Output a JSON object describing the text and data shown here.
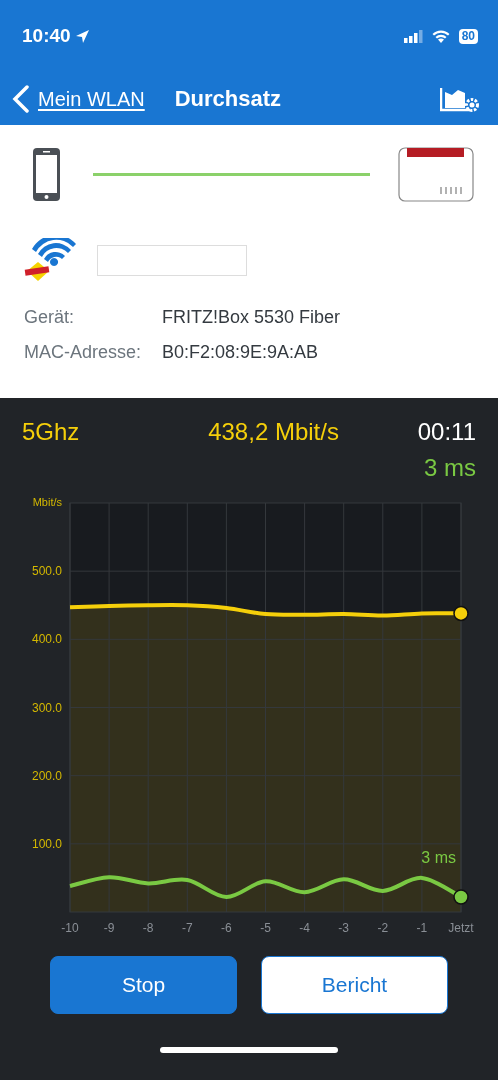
{
  "status_bar": {
    "time": "10:40",
    "battery": "80"
  },
  "nav": {
    "back_label": "Mein WLAN",
    "title": "Durchsatz"
  },
  "details": [
    {
      "label": "Gerät:",
      "value": "FRITZ!Box 5530 Fiber"
    },
    {
      "label": "MAC-Adresse:",
      "value": "B0:F2:08:9E:9A:AB"
    }
  ],
  "measurement": {
    "band": "5Ghz",
    "rate": "438,2 Mbit/s",
    "elapsed": "00:11",
    "latency": "3 ms"
  },
  "chart_data": {
    "type": "area",
    "ylabel": "Mbit/s",
    "x": [
      -10,
      -9,
      -8,
      -7,
      -6,
      -5,
      -4,
      -3,
      -2,
      -1,
      0
    ],
    "ylim": [
      0,
      600
    ],
    "xlim": [
      -10,
      0
    ],
    "grid": true,
    "yticks": [
      {
        "value": 100,
        "label": "100.0"
      },
      {
        "value": 200,
        "label": "200.0"
      },
      {
        "value": 300,
        "label": "300.0"
      },
      {
        "value": 400,
        "label": "400.0"
      },
      {
        "value": 500,
        "label": "500.0"
      }
    ],
    "xticks": [
      -10,
      -9,
      -8,
      -7,
      -6,
      -5,
      -4,
      -3,
      -2,
      -1,
      {
        "value": 0,
        "label": "Jetzt"
      }
    ],
    "series": [
      {
        "color": "#f5cf0a",
        "values": [
          447,
          449,
          450,
          450,
          446,
          437,
          436,
          437,
          435,
          438,
          438
        ]
      },
      {
        "name": "3 ms",
        "type": "line",
        "color": "#7ac943",
        "values": [
          38,
          51,
          42,
          47,
          22,
          45,
          29,
          48,
          31,
          50,
          22
        ]
      }
    ]
  },
  "buttons": [
    {
      "label": "Stop",
      "kind": "primary"
    },
    {
      "label": "Bericht",
      "kind": "outline"
    }
  ]
}
